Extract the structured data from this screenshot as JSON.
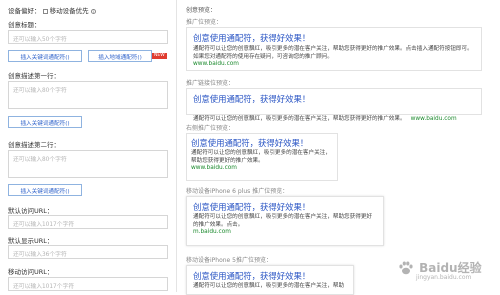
{
  "left": {
    "device_pref_label": "设备偏好：",
    "mobile_pref_label": "移动设备优先",
    "creative_title_label": "创意标题：",
    "creative_title_placeholder": "还可以输入50个字符",
    "insert_keyword_wildcard": "插入关键词通配符()",
    "insert_region_wildcard": "插入地域通配符()",
    "new_badge": "NEW",
    "desc1_label": "创意描述第一行：",
    "desc1_placeholder": "还可以输入80个字符",
    "desc2_label": "创意描述第二行：",
    "desc2_placeholder": "还可以输入80个字符",
    "default_visit_url_label": "默认访问URL：",
    "default_visit_url_placeholder": "还可以输入1017个字符",
    "default_display_url_label": "默认显示URL：",
    "default_display_url_placeholder": "还可以输入36个字符",
    "mobile_visit_url_label": "移动访问URL：",
    "mobile_visit_url_placeholder": "还可以输入1017个字符"
  },
  "right": {
    "preview_header": "创意预览：",
    "ad_preview_label": "推广位预览：",
    "link_preview_label": "推广链接位预览：",
    "right_side_preview_label": "右侧推广位预览：",
    "iphone6plus_preview_label": "移动设备iPhone 6 plus 推广位预览：",
    "iphone5_preview_label": "移动设备iPhone 5推广位预览：",
    "ad_title": "创意使用通配符，获得好效果！",
    "ad_desc_main": "通配符可以让您的创意飘红，吸引更多的潜在客户关注，帮助您获得更好的推广效果。点击插入通配符按钮即可。如果您对通配符的使用存在疑问，可咨询您的推广顾问。",
    "ad_desc_link": "通配符可以让您的创意飘红，吸引更多的潜在客户关注，帮助您获得更好的推广效果。",
    "ad_desc_right": "通配符可以让您的创意飘红，吸引更多的潜在客户关注，帮助您获得更好的推广效果。",
    "ad_desc_mobile": "通配符可以让您的创意飘红，吸引更多的潜在客户关注，帮助您获得更好的推广效果。点击。",
    "ad_desc_mobile5": "通配符可以让您的创意飘红，吸引更多的潜在客户关注，帮助",
    "url": "www.baidu.com",
    "mobile_url": "m.baidu.com"
  },
  "watermark": {
    "brand": "Baidu经验",
    "domain": "jingyan.baidu.com"
  }
}
